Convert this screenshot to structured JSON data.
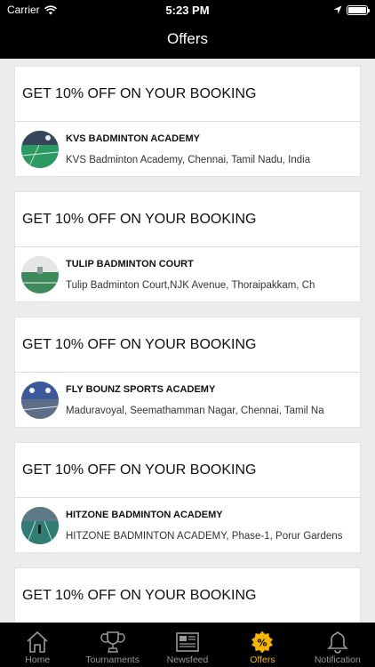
{
  "status_bar": {
    "carrier": "Carrier",
    "time": "5:23 PM"
  },
  "header": {
    "title": "Offers"
  },
  "offers": [
    {
      "title": "GET 10% OFF ON YOUR BOOKING",
      "venue_name": "KVS BADMINTON ACADEMY",
      "venue_address": "KVS Badminton Academy, Chennai, Tamil Nadu, India"
    },
    {
      "title": "GET 10% OFF ON YOUR BOOKING",
      "venue_name": "TULIP BADMINTON COURT",
      "venue_address": "Tulip Badminton Court,NJK Avenue, Thoraipakkam, Ch"
    },
    {
      "title": "GET 10% OFF ON YOUR BOOKING",
      "venue_name": "FLY BOUNZ SPORTS ACADEMY",
      "venue_address": "Maduravoyal, Seemathamman Nagar, Chennai, Tamil Na"
    },
    {
      "title": "GET 10% OFF ON YOUR BOOKING",
      "venue_name": "HITZONE BADMINTON ACADEMY",
      "venue_address": "HITZONE BADMINTON ACADEMY, Phase-1, Porur Gardens"
    },
    {
      "title": "GET 10% OFF ON YOUR BOOKING"
    }
  ],
  "tabs": [
    {
      "label": "Home",
      "icon": "home-icon"
    },
    {
      "label": "Tournaments",
      "icon": "trophy-icon"
    },
    {
      "label": "Newsfeed",
      "icon": "newspaper-icon"
    },
    {
      "label": "Offers",
      "icon": "offers-badge-icon",
      "active": true
    },
    {
      "label": "Notification",
      "icon": "bell-icon"
    }
  ],
  "colors": {
    "bar_background": "#000000",
    "active_tab": "#f5b400",
    "inactive_tab": "#9a9a9a",
    "page_background": "#ececec"
  }
}
